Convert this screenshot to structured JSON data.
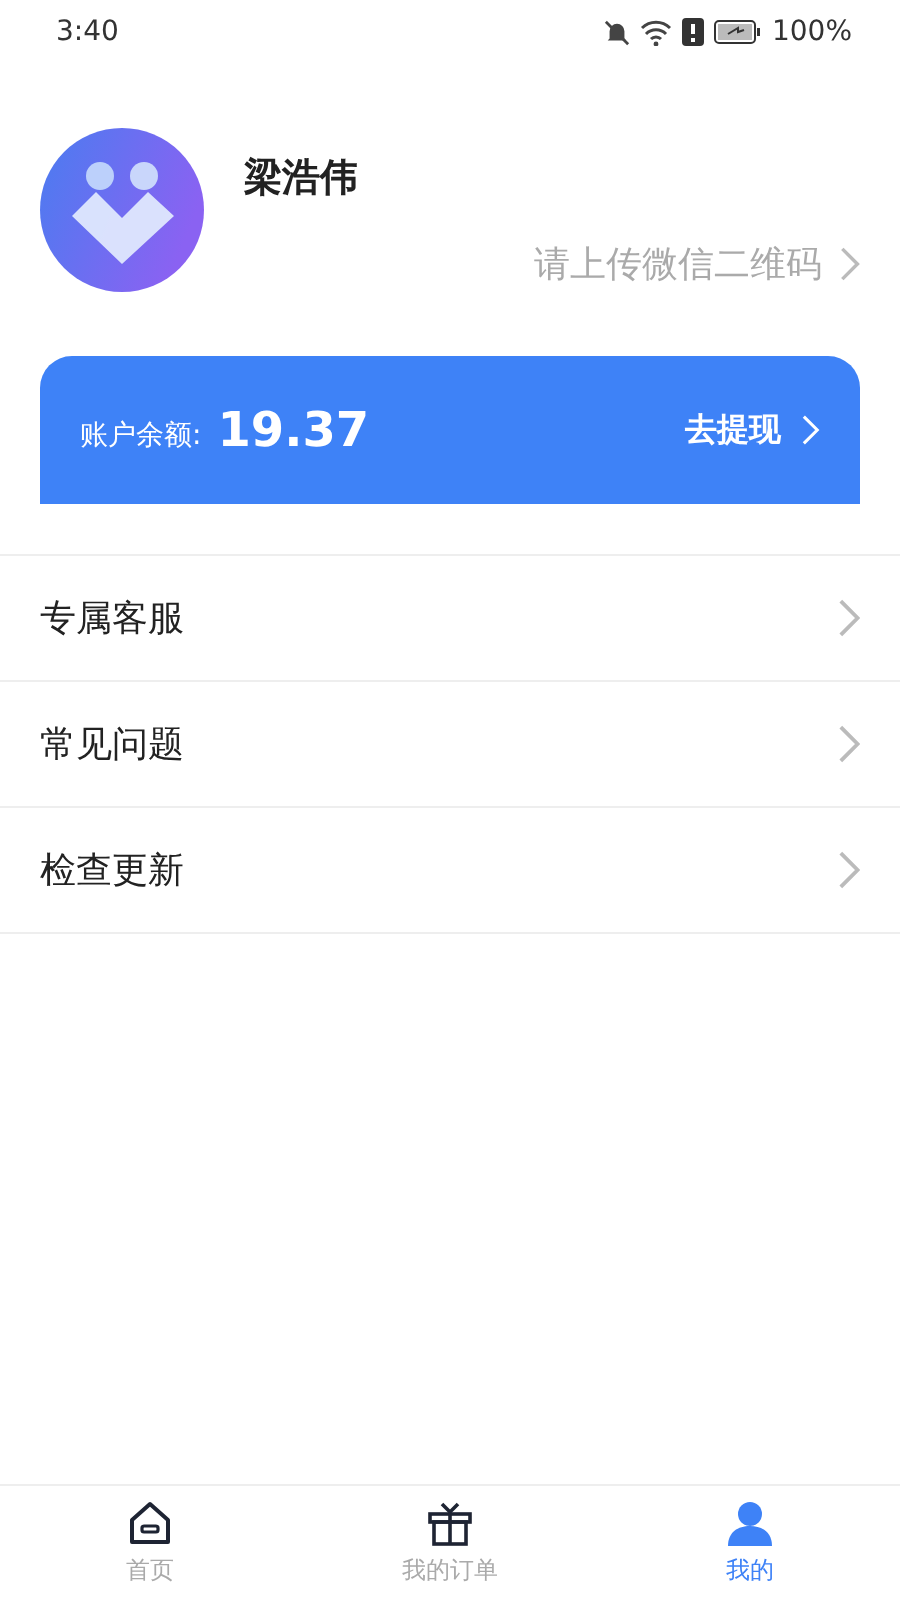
{
  "status_bar": {
    "time": "3:40",
    "battery": "100%"
  },
  "profile": {
    "name": "梁浩伟",
    "qr_prompt": "请上传微信二维码"
  },
  "balance_card": {
    "label": "账户余额:",
    "amount": "19.37",
    "action": "去提现"
  },
  "menu": [
    {
      "label": "专属客服"
    },
    {
      "label": "常见问题"
    },
    {
      "label": "检查更新"
    }
  ],
  "tabs": [
    {
      "kind": "home",
      "label": "首页",
      "selected": false
    },
    {
      "kind": "gift",
      "label": "我的订单",
      "selected": false
    },
    {
      "kind": "user",
      "label": "我的",
      "selected": true
    }
  ]
}
